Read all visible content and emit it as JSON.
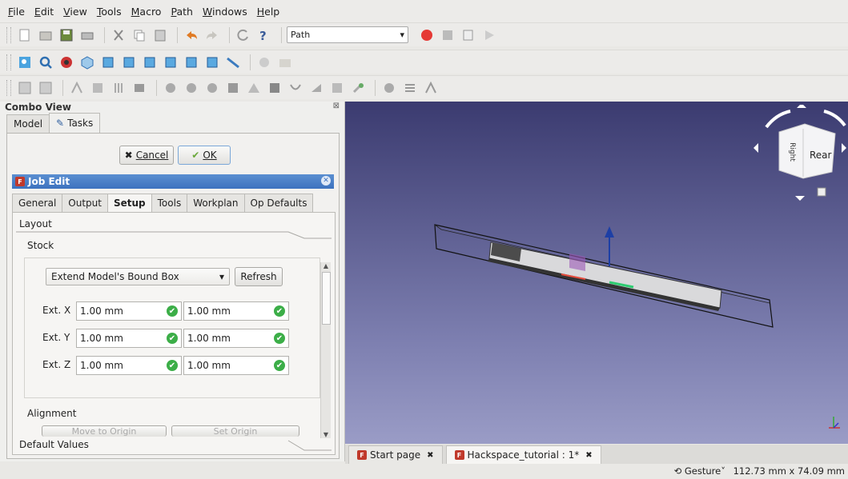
{
  "menu": [
    "File",
    "Edit",
    "View",
    "Tools",
    "Macro",
    "Path",
    "Windows",
    "Help"
  ],
  "workbench": {
    "selected": "Path"
  },
  "combo": {
    "title": "Combo View",
    "tabs": [
      "Model",
      "Tasks"
    ],
    "active_tab": "Tasks"
  },
  "tasks": {
    "cancel_label": "Cancel",
    "ok_label": "OK"
  },
  "job": {
    "title": "Job Edit",
    "tabs": [
      "General",
      "Output",
      "Setup",
      "Tools",
      "Workplan",
      "Op Defaults"
    ],
    "active_tab": "Setup",
    "layout_label": "Layout",
    "stock_label": "Stock",
    "stock_mode": "Extend Model's Bound Box",
    "refresh_label": "Refresh",
    "ext": [
      {
        "label": "Ext. X",
        "neg": "1.00 mm",
        "pos": "1.00 mm"
      },
      {
        "label": "Ext. Y",
        "neg": "1.00 mm",
        "pos": "1.00 mm"
      },
      {
        "label": "Ext. Z",
        "neg": "1.00 mm",
        "pos": "1.00 mm"
      }
    ],
    "alignment_label": "Alignment",
    "move_origin_label": "Move to Origin",
    "set_origin_label": "Set Origin",
    "default_values_label": "Default Values"
  },
  "navcube": {
    "face_left": "Right",
    "face_front": "Rear"
  },
  "doc_tabs": [
    {
      "label": "Start page"
    },
    {
      "label": "Hackspace_tutorial : 1*"
    }
  ],
  "status": {
    "nav_mode": "Gesture",
    "dimensions": "112.73 mm x 74.09 mm"
  },
  "colors": {
    "accent": "#3c72bf",
    "record": "#e53935",
    "check": "#3cae48"
  }
}
